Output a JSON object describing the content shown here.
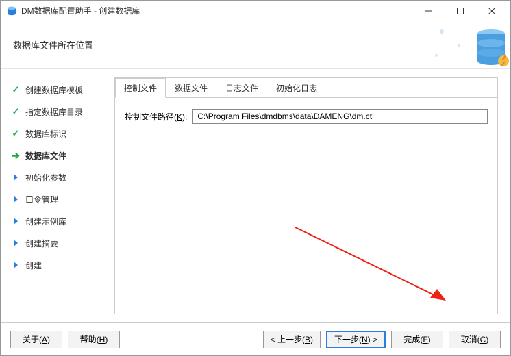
{
  "window": {
    "title": "DM数据库配置助手 - 创建数据库"
  },
  "header": {
    "subtitle": "数据库文件所在位置"
  },
  "steps": [
    {
      "label": "创建数据库模板",
      "status": "done"
    },
    {
      "label": "指定数据库目录",
      "status": "done"
    },
    {
      "label": "数据库标识",
      "status": "done"
    },
    {
      "label": "数据库文件",
      "status": "active"
    },
    {
      "label": "初始化参数",
      "status": "pending"
    },
    {
      "label": "口令管理",
      "status": "pending"
    },
    {
      "label": "创建示例库",
      "status": "pending"
    },
    {
      "label": "创建摘要",
      "status": "pending"
    },
    {
      "label": "创建",
      "status": "pending"
    }
  ],
  "tabs": [
    {
      "label": "控制文件",
      "active": true
    },
    {
      "label": "数据文件",
      "active": false
    },
    {
      "label": "日志文件",
      "active": false
    },
    {
      "label": "初始化日志",
      "active": false
    }
  ],
  "form": {
    "path_label_pre": "控制文件路径(",
    "path_label_key": "K",
    "path_label_post": "):",
    "path_value": "C:\\Program Files\\dmdbms\\data\\DAMENG\\dm.ctl"
  },
  "buttons": {
    "about_pre": "关于(",
    "about_key": "A",
    "about_post": ")",
    "help_pre": "帮助(",
    "help_key": "H",
    "help_post": ")",
    "back_pre": "< 上一步(",
    "back_key": "B",
    "back_post": ")",
    "next_pre": "下一步(",
    "next_key": "N",
    "next_post": ") >",
    "finish_pre": "完成(",
    "finish_key": "F",
    "finish_post": ")",
    "cancel_pre": "取消(",
    "cancel_key": "C",
    "cancel_post": ")"
  }
}
